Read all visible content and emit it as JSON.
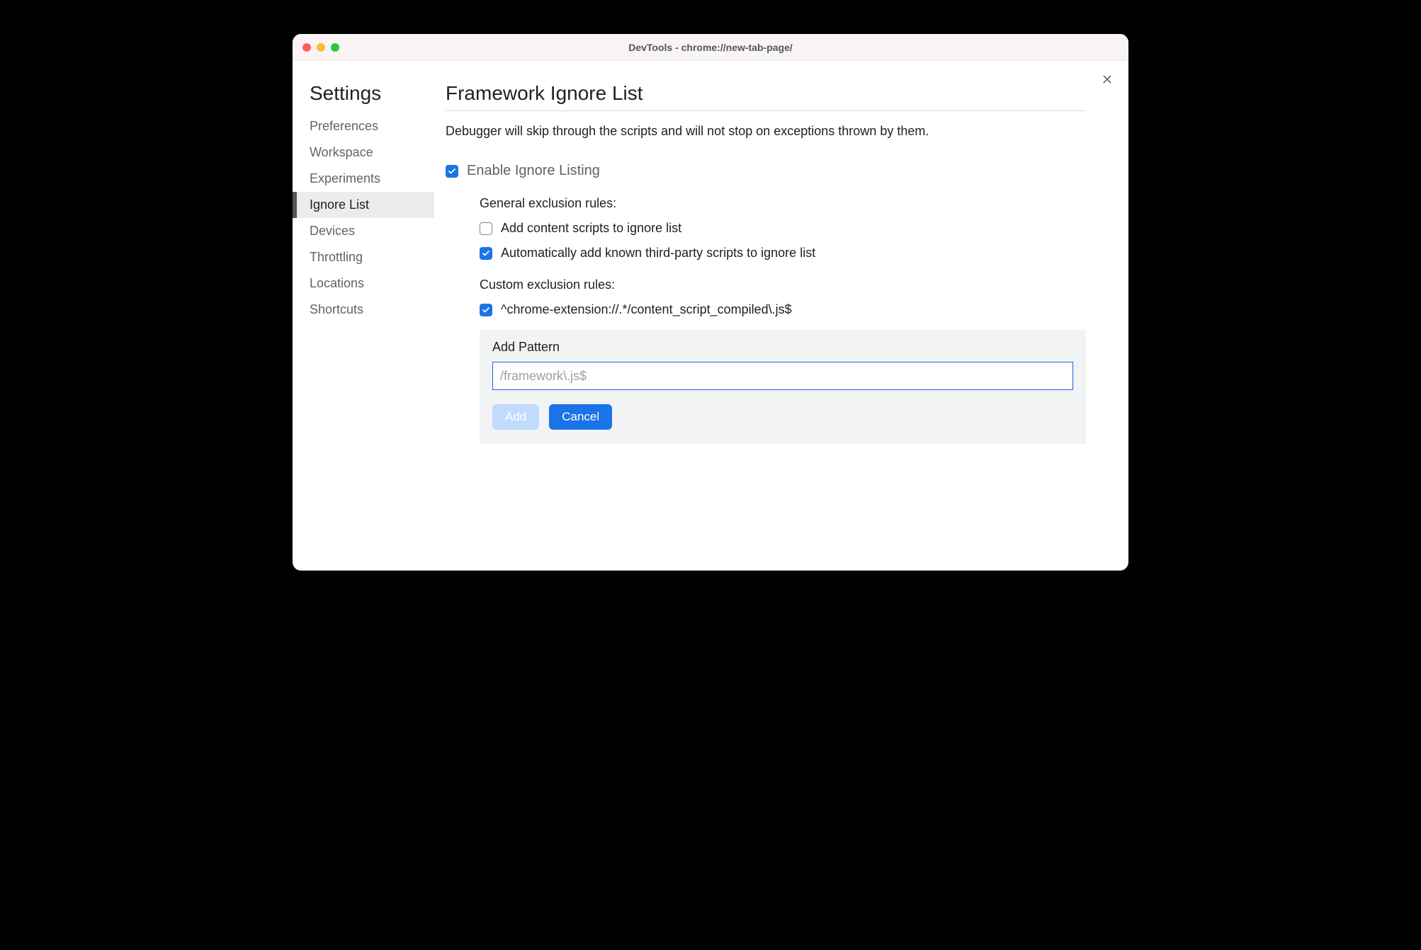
{
  "titlebar": {
    "title": "DevTools - chrome://new-tab-page/"
  },
  "sidebar": {
    "title": "Settings",
    "items": [
      {
        "label": "Preferences",
        "active": false
      },
      {
        "label": "Workspace",
        "active": false
      },
      {
        "label": "Experiments",
        "active": false
      },
      {
        "label": "Ignore List",
        "active": true
      },
      {
        "label": "Devices",
        "active": false
      },
      {
        "label": "Throttling",
        "active": false
      },
      {
        "label": "Locations",
        "active": false
      },
      {
        "label": "Shortcuts",
        "active": false
      }
    ]
  },
  "main": {
    "heading": "Framework Ignore List",
    "description": "Debugger will skip through the scripts and will not stop on exceptions thrown by them.",
    "enable_label": "Enable Ignore Listing",
    "enable_checked": true,
    "general_section_label": "General exclusion rules:",
    "general_rules": [
      {
        "label": "Add content scripts to ignore list",
        "checked": false
      },
      {
        "label": "Automatically add known third-party scripts to ignore list",
        "checked": true
      }
    ],
    "custom_section_label": "Custom exclusion rules:",
    "custom_rules": [
      {
        "label": "^chrome-extension://.*/content_script_compiled\\.js$",
        "checked": true
      }
    ],
    "add_panel": {
      "title": "Add Pattern",
      "placeholder": "/framework\\.js$",
      "value": "",
      "add_label": "Add",
      "cancel_label": "Cancel"
    }
  }
}
